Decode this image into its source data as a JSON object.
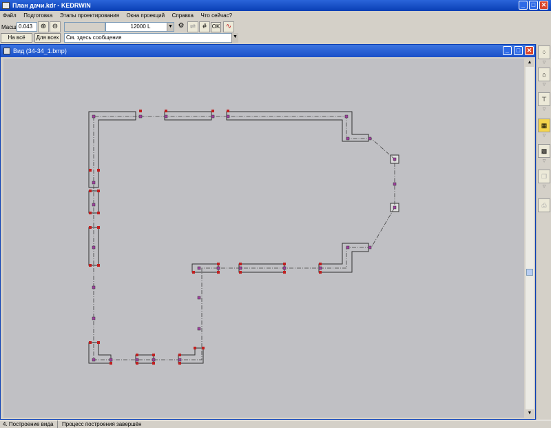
{
  "app": {
    "title": "План дачи.kdr - KEDRWIN",
    "window_buttons": {
      "minimize": "_",
      "maximize": "□",
      "close": "✕"
    }
  },
  "menu": [
    "Файл",
    "Подготовка",
    "Этапы проектирования",
    "Окна проекций",
    "Справка",
    "Что сейчас?"
  ],
  "toolbar": {
    "scale_label": "Масшт",
    "scale_value": "0.043",
    "fit_all_button": "На всё окно",
    "for_all_button": "Для всех",
    "layer_value": "12000 L",
    "ok_button": "OK",
    "message_placeholder": "См. здесь сообщения"
  },
  "view_window": {
    "title": "Вид (34-34_1.bmp)"
  },
  "status": {
    "stage": "4. Построение вида",
    "message": "Процесс построения завершён"
  },
  "colors": {
    "canvas": "#c0c0c4",
    "wall": "#303030",
    "axis": "#404040",
    "node_red": "#c02020",
    "node_purple": "#a040a0",
    "accent": "#f4d44c"
  },
  "icons": {
    "zoom_in": "zoom-in-icon",
    "zoom_out": "zoom-out-icon",
    "gear": "gear-icon",
    "grid": "grid-icon",
    "tool_1": "nodes-icon",
    "tool_2": "house-outline-icon",
    "tool_3": "wall-icon",
    "tool_4": "building-icon",
    "tool_5": "hatch-icon",
    "tool_6": "pages-icon",
    "tool_7": "print-icon"
  }
}
